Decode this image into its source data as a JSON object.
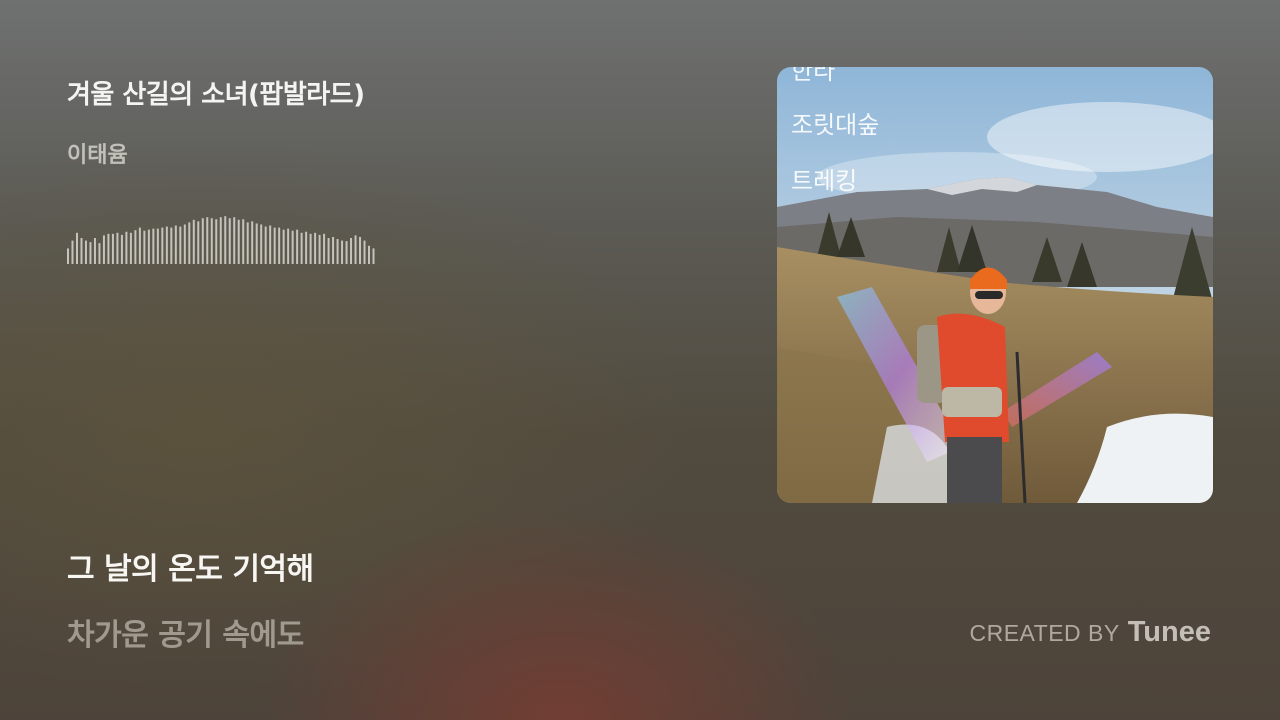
{
  "song": {
    "title": "겨울 산길의 소녀(팝발라드)",
    "artist": "이태윰"
  },
  "lyrics": {
    "current": "그 날의 온도 기억해",
    "next": "차가운 공기 속에도"
  },
  "cover": {
    "overlay_lines": [
      "한라",
      "조릿대숲",
      "트레킹"
    ]
  },
  "credit": {
    "prefix": "CREATED BY",
    "brand": "Tunee"
  },
  "waveform": {
    "levels": [
      0.3,
      0.45,
      0.6,
      0.5,
      0.45,
      0.42,
      0.5,
      0.4,
      0.55,
      0.58,
      0.58,
      0.6,
      0.56,
      0.62,
      0.6,
      0.65,
      0.7,
      0.64,
      0.66,
      0.68,
      0.68,
      0.7,
      0.72,
      0.7,
      0.74,
      0.72,
      0.76,
      0.8,
      0.85,
      0.82,
      0.88,
      0.9,
      0.88,
      0.86,
      0.9,
      0.92,
      0.88,
      0.9,
      0.85,
      0.86,
      0.8,
      0.82,
      0.78,
      0.76,
      0.72,
      0.74,
      0.7,
      0.7,
      0.66,
      0.68,
      0.64,
      0.66,
      0.6,
      0.62,
      0.58,
      0.6,
      0.56,
      0.58,
      0.5,
      0.52,
      0.48,
      0.45,
      0.44,
      0.5,
      0.55,
      0.52,
      0.45,
      0.35,
      0.3
    ],
    "color": "#d8d6d0"
  },
  "colors": {
    "title": "#f4f4f2",
    "accent_warm": "#7a3c32"
  }
}
